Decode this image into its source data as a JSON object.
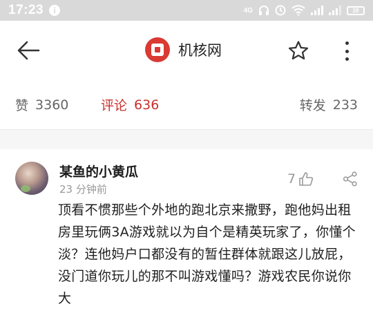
{
  "status_bar": {
    "time": "17:23",
    "info_badge": "i",
    "network_label": "4G",
    "battery": "28"
  },
  "header": {
    "title": "机核网"
  },
  "stats": {
    "likes_label": "赞",
    "likes_count": "3360",
    "comments_label": "评论",
    "comments_count": "636",
    "shares_label": "转发",
    "shares_count": "233"
  },
  "comment": {
    "username": "某鱼的小黄瓜",
    "time_ago": "23 分钟前",
    "likes": "7",
    "text": "顶看不惯那些个外地的跑北京来撒野，跑他妈出租房里玩俩3A游戏就以为自个是精英玩家了，你懂个淡？连他妈户口都没有的暂住群体就跟这儿放屁，没门道你玩儿的那不叫游戏懂吗？游戏农民你说你大"
  },
  "colors": {
    "accent": "#c9302c",
    "logo": "#d93a33",
    "status_bar": "#d9d9d9"
  }
}
